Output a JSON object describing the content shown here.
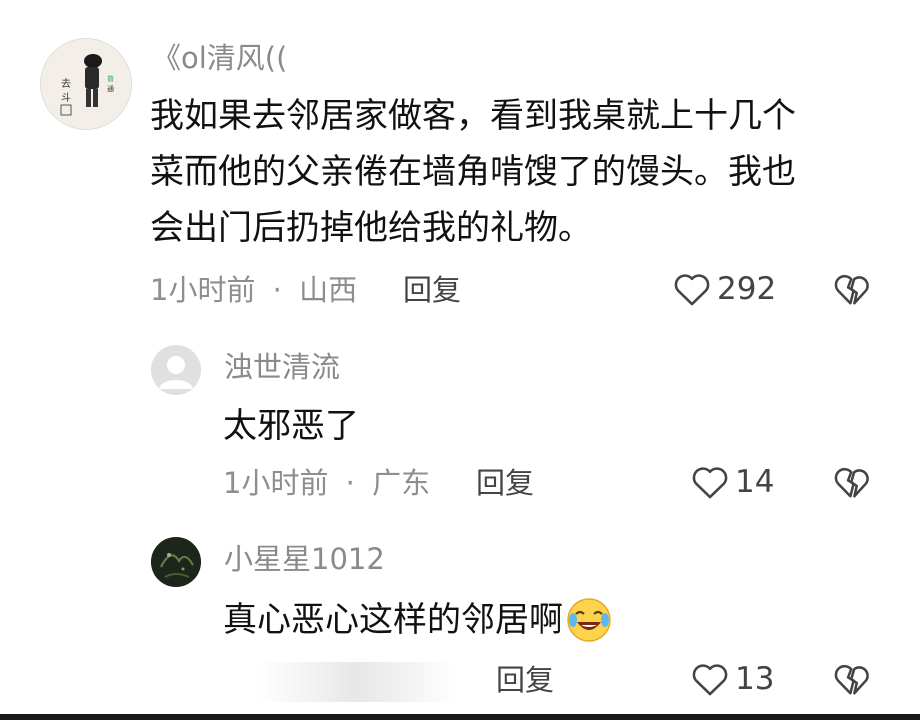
{
  "comments": [
    {
      "username": "《ol清风((",
      "avatar_icon": "sketch-portrait-avatar",
      "lines": [
        "我如果去邻居家做客，看到我桌就上十几个",
        "菜而他的父亲倦在墙角啃馊了的馒头。我也",
        "会出门后扔掉他给我的礼物。"
      ],
      "time": "1小时前",
      "location": "山西",
      "reply_label": "回复",
      "like_count": "292"
    },
    {
      "username": "浊世清流",
      "avatar_icon": "default-user-avatar",
      "text": "太邪恶了",
      "time": "1小时前",
      "location": "广东",
      "reply_label": "回复",
      "like_count": "14"
    },
    {
      "username": "小星星1012",
      "avatar_icon": "dark-green-photo-avatar",
      "text": "真心恶心这样的邻居啊",
      "emoji_icon": "laughing-crying-emoji",
      "reply_label": "回复",
      "like_count": "13"
    }
  ],
  "separator": "·",
  "colors": {
    "meta": "#8e8e8e",
    "text": "#111111",
    "heart_stroke": "#444444"
  }
}
